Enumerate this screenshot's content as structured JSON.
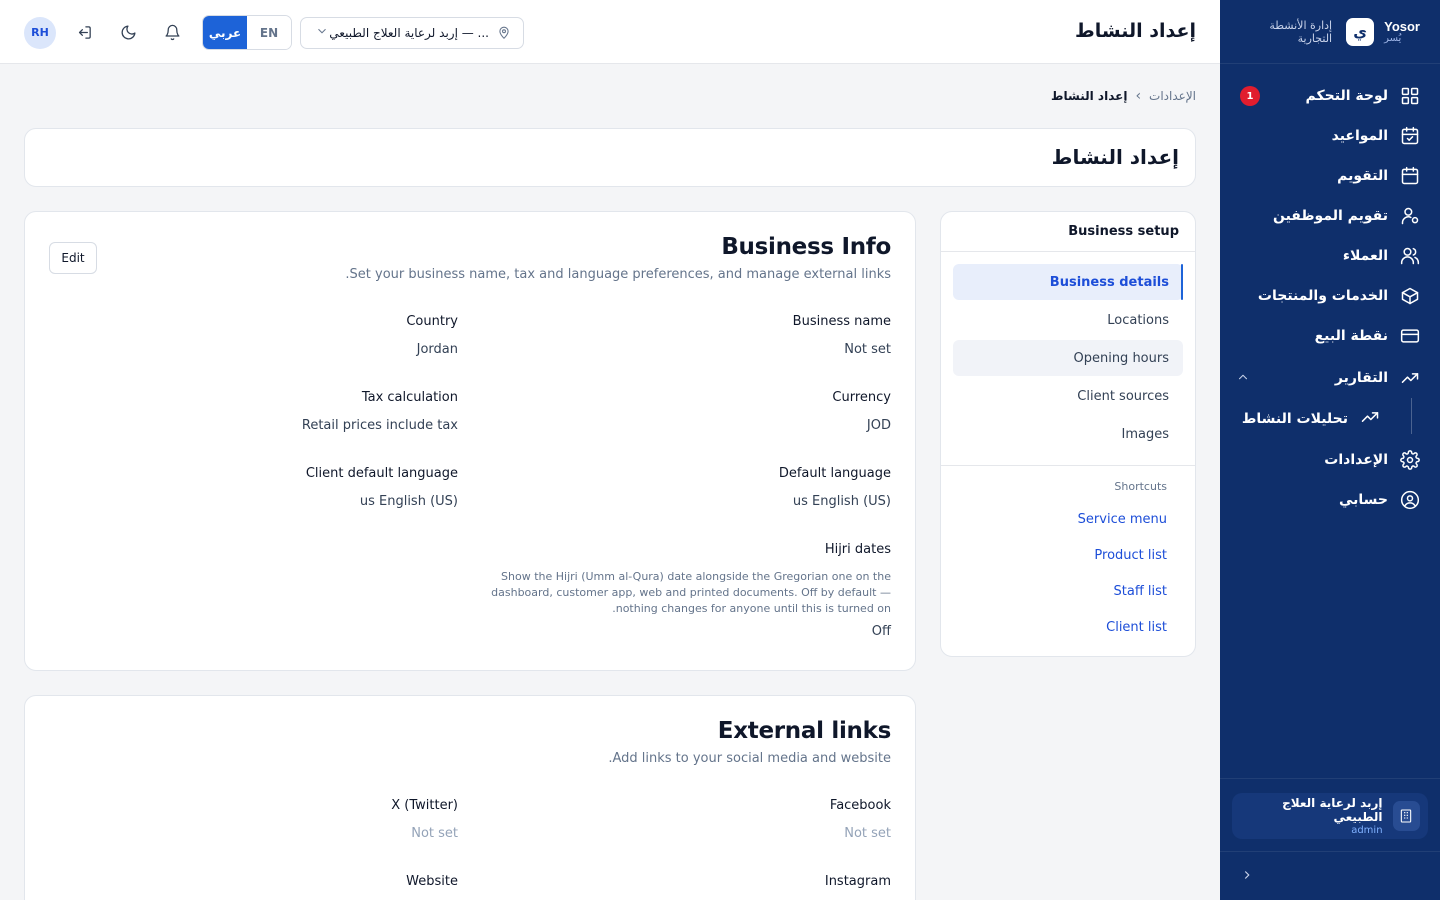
{
  "brand": {
    "name": "Yosor",
    "name_ar": "يُسر",
    "logo_letter": "ي",
    "subtitle_line1": "إدارة الأنشطة",
    "subtitle_line2": "التجارية"
  },
  "sidebar": {
    "items": [
      {
        "label": "لوحة التحكم",
        "icon": "dashboard-grid-icon",
        "badge": "1"
      },
      {
        "label": "المواعيد",
        "icon": "calendar-check-icon"
      },
      {
        "label": "التقويم",
        "icon": "calendar-icon"
      },
      {
        "label": "تقويم الموظفين",
        "icon": "user-gear-icon"
      },
      {
        "label": "العملاء",
        "icon": "users-icon"
      },
      {
        "label": "الخدمات والمنتجات",
        "icon": "box-icon"
      },
      {
        "label": "نقطة البيع",
        "icon": "credit-card-icon"
      },
      {
        "label": "التقارير",
        "icon": "trending-up-icon",
        "expanded": true
      },
      {
        "label": "الإعدادات",
        "icon": "gear-icon"
      },
      {
        "label": "حسابي",
        "icon": "user-circle-icon"
      }
    ],
    "sub_items": [
      {
        "label": "تحليلات النشاط",
        "icon": "trending-up-icon"
      }
    ],
    "footer": {
      "business_name": "إربد لرعاية العلاج الطبيعي",
      "role": "admin"
    }
  },
  "header": {
    "title": "إعداد النشاط",
    "location_select": "إربد لرعاية العلاج الطبيعي — ...",
    "lang_ar": "عربي",
    "lang_en": "EN",
    "avatar_initials": "RH"
  },
  "breadcrumb": {
    "parent": "الإعدادات",
    "current": "إعداد النشاط"
  },
  "page_title": "إعداد النشاط",
  "setup_nav": {
    "heading": "Business setup",
    "items": [
      "Business details",
      "Locations",
      "Opening hours",
      "Client sources",
      "Images"
    ],
    "shortcuts_heading": "Shortcuts",
    "shortcuts": [
      "Service menu",
      "Product list",
      "Staff list",
      "Client list"
    ]
  },
  "business_info": {
    "title": "Business Info",
    "subtitle": "Set your business name, tax and language preferences, and manage external links.",
    "edit_label": "Edit",
    "fields": {
      "business_name": {
        "label": "Business name",
        "value": "Not set"
      },
      "country": {
        "label": "Country",
        "value": "Jordan"
      },
      "currency": {
        "label": "Currency",
        "value": "JOD"
      },
      "tax": {
        "label": "Tax calculation",
        "value": "Retail prices include tax"
      },
      "default_language": {
        "label": "Default language",
        "value": "us English (US)"
      },
      "client_language": {
        "label": "Client default language",
        "value": "us English (US)"
      },
      "hijri": {
        "label": "Hijri dates",
        "description": "Show the Hijri (Umm al-Qura) date alongside the Gregorian one on the dashboard, customer app, web and printed documents. Off by default — nothing changes for anyone until this is turned on.",
        "value": "Off"
      }
    }
  },
  "external_links": {
    "title": "External links",
    "subtitle": "Add links to your social media and website.",
    "fields": {
      "facebook": {
        "label": "Facebook",
        "value": "Not set"
      },
      "twitter": {
        "label": "X (Twitter)",
        "value": "Not set"
      },
      "instagram": {
        "label": "Instagram",
        "value": ""
      },
      "website": {
        "label": "Website",
        "value": ""
      }
    }
  },
  "colors": {
    "sidebar_bg": "#0f2f6b",
    "accent": "#1d63d8",
    "badge": "#e11d2e"
  }
}
